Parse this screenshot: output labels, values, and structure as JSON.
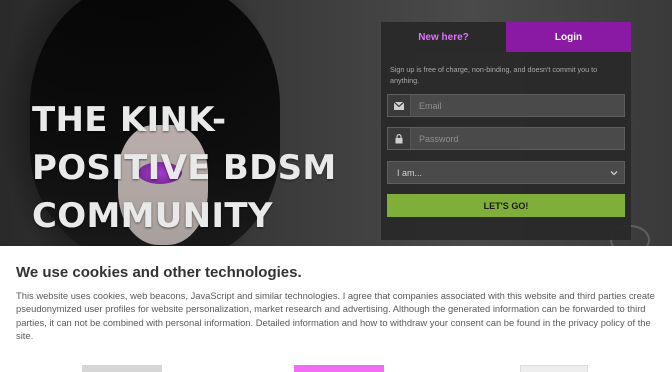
{
  "hero": {
    "headline_lines": [
      "THE KINK-",
      "POSITIVE BDSM",
      "COMMUNITY FOR"
    ]
  },
  "panel": {
    "tabs": [
      "New here?",
      "Login"
    ],
    "intro": "Sign up is free of charge, non-binding, and doesn't commit you to anything.",
    "email_placeholder": "Email",
    "password_placeholder": "Password",
    "select_value": "I am...",
    "submit_label": "LET'S GO!"
  },
  "cookie": {
    "title": "We use cookies and other technologies.",
    "text": "This website uses cookies, web beacons, JavaScript and similar technologies. I agree that companies associated with this website and third parties create pseudonymized user profiles for website personalization, market research and advertising. Although the generated information can be forwarded to third parties, it can not be combined with personal information. Detailed information and how to withdraw your consent can be found in the privacy policy of the site."
  },
  "colors": {
    "accent_purple": "#8a1aa3",
    "tab_text_purple": "#e070ff",
    "go_green": "#7fae3a",
    "cookie_primary_pink": "#f26cf4"
  },
  "icons": [
    "envelope-icon",
    "lock-icon",
    "chevron-down-icon"
  ]
}
